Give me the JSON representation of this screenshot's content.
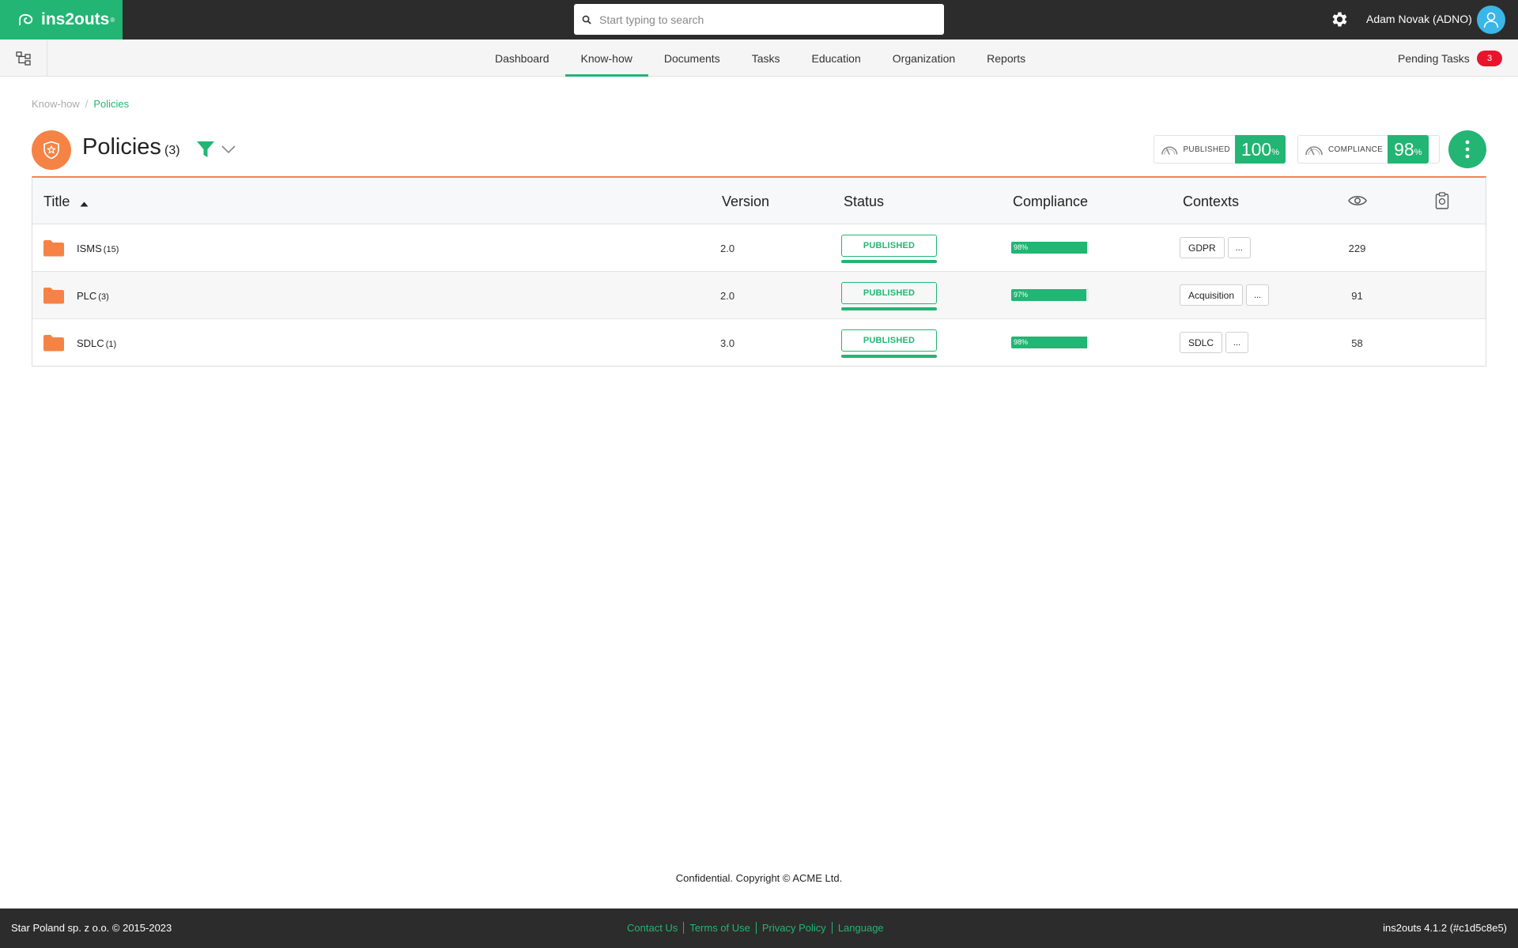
{
  "app": {
    "name": "ins2outs",
    "trademark": "®"
  },
  "search": {
    "placeholder": "Start typing to search"
  },
  "user": {
    "name": "Adam Novak (ADNO)"
  },
  "nav": {
    "items": [
      "Dashboard",
      "Know-how",
      "Documents",
      "Tasks",
      "Education",
      "Organization",
      "Reports"
    ],
    "active": "Know-how"
  },
  "pending": {
    "label": "Pending Tasks",
    "count": "3"
  },
  "breadcrumb": {
    "parent": "Know-how",
    "separator": "/",
    "current": "Policies"
  },
  "page": {
    "title": "Policies",
    "count": "(3)"
  },
  "stats": {
    "published": {
      "label": "PUBLISHED",
      "value": "100",
      "unit": "%"
    },
    "compliance": {
      "label": "COMPLIANCE",
      "value": "98",
      "unit": "%"
    }
  },
  "table": {
    "columns": {
      "title": "Title",
      "version": "Version",
      "status": "Status",
      "compliance": "Compliance",
      "contexts": "Contexts"
    },
    "rows": [
      {
        "title": "ISMS",
        "count": "(15)",
        "version": "2.0",
        "status": "PUBLISHED",
        "compliance_label": "98%",
        "compliance_pct": 98,
        "context": "GDPR",
        "more": "...",
        "views": "229"
      },
      {
        "title": "PLC",
        "count": "(3)",
        "version": "2.0",
        "status": "PUBLISHED",
        "compliance_label": "97%",
        "compliance_pct": 97,
        "context": "Acquisition",
        "more": "...",
        "views": "91"
      },
      {
        "title": "SDLC",
        "count": "(1)",
        "version": "3.0",
        "status": "PUBLISHED",
        "compliance_label": "98%",
        "compliance_pct": 98,
        "context": "SDLC",
        "more": "...",
        "views": "58"
      }
    ]
  },
  "confidential": "Confidential. Copyright © ACME Ltd.",
  "footer": {
    "copyright": "Star Poland sp. z o.o. © 2015-2023",
    "links": [
      "Contact Us",
      "Terms of Use",
      "Privacy Policy",
      "Language"
    ],
    "version": "ins2outs 4.1.2 (#c1d5c8e5)"
  },
  "colors": {
    "brand": "#22b573",
    "accent": "#f58345",
    "badge": "#e8142b",
    "topbar": "#2c2c2c"
  },
  "icons": [
    "logo-icon",
    "search-icon",
    "gear-icon",
    "user-icon",
    "tree-icon",
    "shield-icon",
    "filter-icon",
    "chevron-down-icon",
    "gauge-icon",
    "more-vertical-icon",
    "sort-up-icon",
    "eye-icon",
    "clipboard-icon",
    "folder-icon"
  ]
}
